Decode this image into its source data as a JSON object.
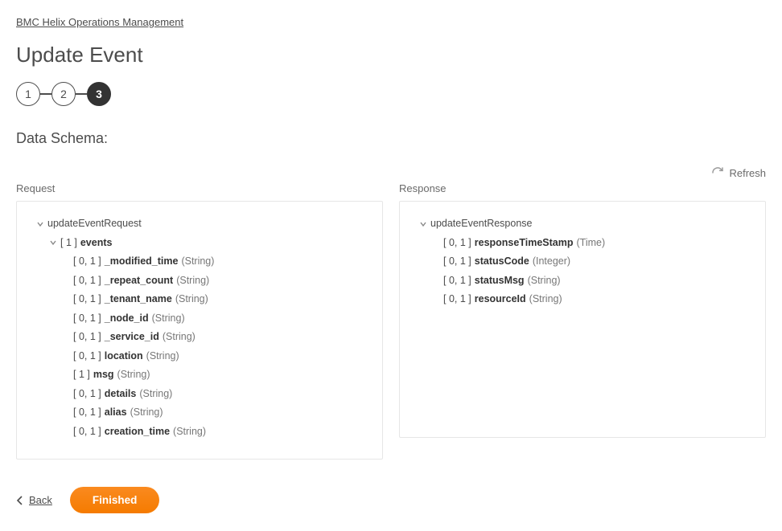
{
  "breadcrumb": {
    "label": "BMC Helix Operations Management"
  },
  "page": {
    "title": "Update Event"
  },
  "stepper": {
    "steps": [
      "1",
      "2",
      "3"
    ],
    "active_index": 2
  },
  "section": {
    "title": "Data Schema:"
  },
  "refresh": {
    "label": "Refresh"
  },
  "request": {
    "label": "Request",
    "root": "updateEventRequest",
    "events_cardinality": "[ 1 ]",
    "events_name": "events",
    "fields": [
      {
        "cardinality": "[ 0, 1 ]",
        "name": "_modified_time",
        "type": "(String)"
      },
      {
        "cardinality": "[ 0, 1 ]",
        "name": "_repeat_count",
        "type": "(String)"
      },
      {
        "cardinality": "[ 0, 1 ]",
        "name": "_tenant_name",
        "type": "(String)"
      },
      {
        "cardinality": "[ 0, 1 ]",
        "name": "_node_id",
        "type": "(String)"
      },
      {
        "cardinality": "[ 0, 1 ]",
        "name": "_service_id",
        "type": "(String)"
      },
      {
        "cardinality": "[ 0, 1 ]",
        "name": "location",
        "type": "(String)"
      },
      {
        "cardinality": "[ 1 ]",
        "name": "msg",
        "type": "(String)"
      },
      {
        "cardinality": "[ 0, 1 ]",
        "name": "details",
        "type": "(String)"
      },
      {
        "cardinality": "[ 0, 1 ]",
        "name": "alias",
        "type": "(String)"
      },
      {
        "cardinality": "[ 0, 1 ]",
        "name": "creation_time",
        "type": "(String)"
      }
    ]
  },
  "response": {
    "label": "Response",
    "root": "updateEventResponse",
    "fields": [
      {
        "cardinality": "[ 0, 1 ]",
        "name": "responseTimeStamp",
        "type": "(Time)"
      },
      {
        "cardinality": "[ 0, 1 ]",
        "name": "statusCode",
        "type": "(Integer)"
      },
      {
        "cardinality": "[ 0, 1 ]",
        "name": "statusMsg",
        "type": "(String)"
      },
      {
        "cardinality": "[ 0, 1 ]",
        "name": "resourceId",
        "type": "(String)"
      }
    ]
  },
  "footer": {
    "back": "Back",
    "finished": "Finished"
  }
}
